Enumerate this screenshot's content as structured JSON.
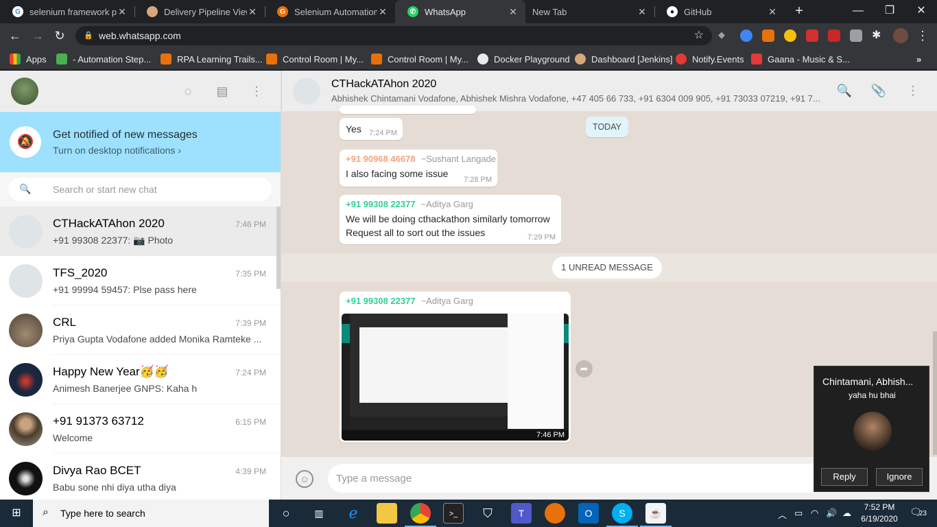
{
  "browser": {
    "tabs": [
      {
        "title": "selenium framework pr",
        "favicon_color": "#4285f4",
        "favicon": "G"
      },
      {
        "title": "Delivery Pipeline View [",
        "favicon_color": "#d6a77a",
        "favicon": ""
      },
      {
        "title": "Selenium Automation F",
        "favicon_color": "#e8710a",
        "favicon": "G"
      },
      {
        "title": "WhatsApp",
        "favicon_color": "#25d366",
        "favicon": "✆"
      },
      {
        "title": "New Tab",
        "favicon_color": "",
        "favicon": ""
      },
      {
        "title": "GitHub",
        "favicon_color": "#ffffff",
        "favicon": ""
      }
    ],
    "url": "web.whatsapp.com",
    "bookmarks": [
      {
        "label": "Apps",
        "color": "#ea4335"
      },
      {
        "label": "- Automation Step...",
        "color": "#4caf50"
      },
      {
        "label": "RPA Learning Trails...",
        "color": "#e8710a"
      },
      {
        "label": "Control Room | My...",
        "color": "#e8710a"
      },
      {
        "label": "Control Room | My...",
        "color": "#e8710a"
      },
      {
        "label": "Docker Playground",
        "color": "#e8eaed"
      },
      {
        "label": "Dashboard [Jenkins]",
        "color": "#d6a77a"
      },
      {
        "label": "Notify.Events",
        "color": "#e53935"
      },
      {
        "label": "Gaana - Music & S...",
        "color": "#e53935"
      }
    ]
  },
  "sidebar": {
    "notification": {
      "title": "Get notified of new messages",
      "subtitle": "Turn on desktop notifications ›"
    },
    "search_placeholder": "Search or start new chat",
    "chats": [
      {
        "name": "CTHackATAhon 2020",
        "time": "7:46 PM",
        "last": "+91 99308 22377: 📷 Photo",
        "avatar_color": "#dfe5e7",
        "selected": true
      },
      {
        "name": "TFS_2020",
        "time": "7:35 PM",
        "last": "+91 99994 59457: Plse pass here",
        "avatar_color": "#dfe5e7",
        "selected": false
      },
      {
        "name": "CRL",
        "time": "7:39 PM",
        "last": "Priya Gupta Vodafone added Monika Ramteke ...",
        "avatar_color": "#8a7a6a",
        "selected": false
      },
      {
        "name": "Happy New Year🥳🥳",
        "time": "7:24 PM",
        "last": "Animesh Banerjee GNPS: Kaha h",
        "avatar_color": "#1a2740",
        "selected": false
      },
      {
        "name": "+91 91373 63712",
        "time": "6:15 PM",
        "last": "Welcome",
        "avatar_color": "#7a6a50",
        "selected": false
      },
      {
        "name": "Divya Rao BCET",
        "time": "4:39 PM",
        "last": "Babu sone nhi diya utha diya",
        "avatar_color": "#111111",
        "selected": false
      }
    ]
  },
  "conversation": {
    "title": "CTHackATAhon 2020",
    "members": "Abhishek Chintamani Vodafone, Abhishek Mishra Vodafone, +47 405 66 733, +91 6304 009 905, +91 73033 07219, +91 7...",
    "messages": [
      {
        "text": "Yes",
        "time": "7:24 PM"
      },
      {
        "sender_number": "+91 90968 46678",
        "sender_name": "~Sushant Langade",
        "sender_color": "#f2a57f",
        "text": "I also facing some issue",
        "time": "7:28 PM"
      },
      {
        "sender_number": "+91 99308 22377",
        "sender_name": "~Aditya Garg",
        "sender_color": "#35cd96",
        "text": "We will be doing cthackathon similarly tomorrow",
        "text2": "Request all to sort out the issues",
        "time": "7:29 PM"
      }
    ],
    "day_label": "TODAY",
    "unread_label": "1 UNREAD MESSAGE",
    "image_message": {
      "sender_number": "+91 99308 22377",
      "sender_name": "~Aditya Garg",
      "sender_color": "#35cd96",
      "time": "7:46 PM"
    },
    "composer_placeholder": "Type a message"
  },
  "toast": {
    "title": "Chintamani, Abhish...",
    "message": "yaha hu bhai",
    "reply_label": "Reply",
    "ignore_label": "Ignore"
  },
  "taskbar": {
    "search_placeholder": "Type here to search",
    "time": "7:52 PM",
    "date": "6/19/2020",
    "notification_count": "23"
  }
}
